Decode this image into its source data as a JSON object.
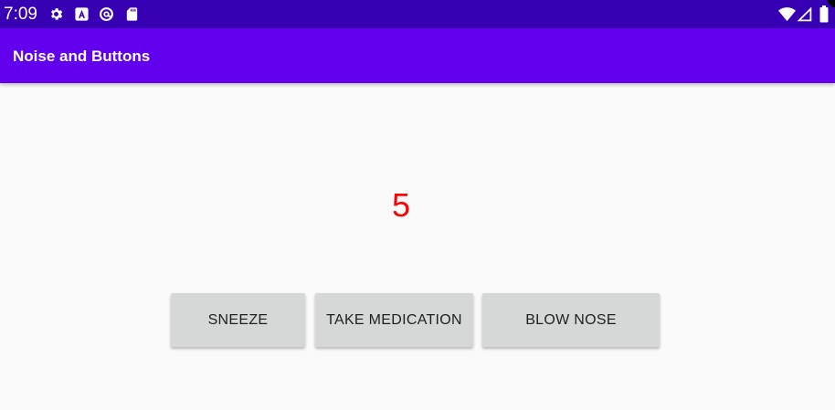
{
  "status_bar": {
    "time": "7:09",
    "left_icons": [
      "gear-icon",
      "accessibility-a-icon",
      "at-sign-icon",
      "sd-card-icon"
    ],
    "right_icons": [
      "wifi-icon",
      "cell-signal-icon",
      "battery-icon"
    ],
    "color": "#3700b3"
  },
  "app_bar": {
    "title": "Noise and Buttons",
    "color": "#6200ee"
  },
  "main": {
    "counter": "5",
    "counter_color": "#ff0000",
    "buttons": {
      "sneeze": "SNEEZE",
      "take_medication": "TAKE MEDICATION",
      "blow_nose": "BLOW NOSE"
    }
  }
}
